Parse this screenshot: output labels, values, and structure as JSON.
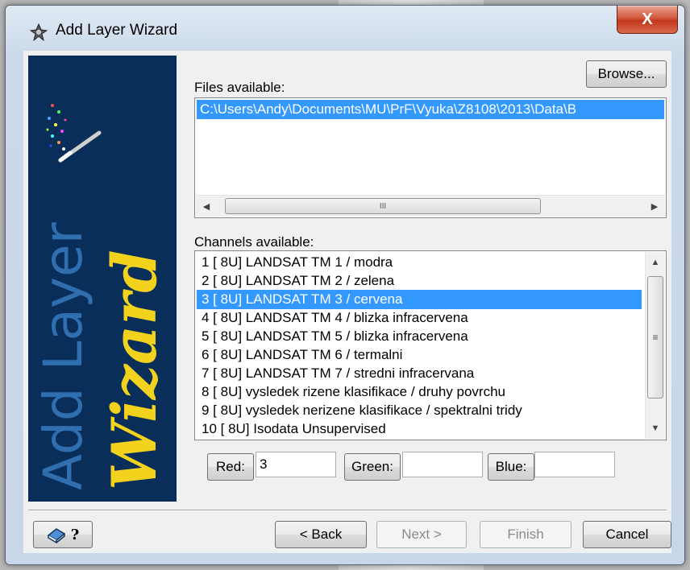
{
  "window": {
    "title": "Add Layer Wizard",
    "close_label": "X"
  },
  "sidebar": {
    "line1": "Add Layer",
    "line2": "Wizard"
  },
  "files": {
    "label": "Files available:",
    "browse_label": "Browse...",
    "items": [
      "C:\\Users\\Andy\\Documents\\MU\\PrF\\Vyuka\\Z8108\\2013\\Data\\B"
    ],
    "scroll_grip": "III"
  },
  "channels": {
    "label": "Channels available:",
    "scroll_grip": "≡",
    "items": [
      "1 [ 8U] LANDSAT TM 1 / modra",
      "2 [ 8U] LANDSAT TM 2 / zelena",
      "3 [ 8U] LANDSAT TM 3 / cervena",
      "4 [ 8U] LANDSAT TM 4 / blizka infracervena",
      "5 [ 8U] LANDSAT TM 5 / blizka infracervena",
      "6 [ 8U] LANDSAT TM 6 / termalni",
      "7 [ 8U] LANDSAT TM 7 / stredni infracervana",
      "8 [ 8U] vysledek rizene klasifikace / druhy povrchu",
      "9 [ 8U] vysledek nerizene klasifikace / spektralni tridy",
      "10 [ 8U] Isodata Unsupervised"
    ]
  },
  "rgb": {
    "red_label": "Red:",
    "red_value": "3",
    "green_label": "Green:",
    "green_value": "",
    "blue_label": "Blue:",
    "blue_value": ""
  },
  "footer": {
    "help_label": "?",
    "back_label": "< Back",
    "next_label": "Next >",
    "finish_label": "Finish",
    "cancel_label": "Cancel"
  },
  "colors": {
    "selection": "#3399ff",
    "sidebar_bg": "#0a2e5a",
    "wizard_yellow": "#f2d21c",
    "add_layer_blue": "#2f6fb0"
  }
}
